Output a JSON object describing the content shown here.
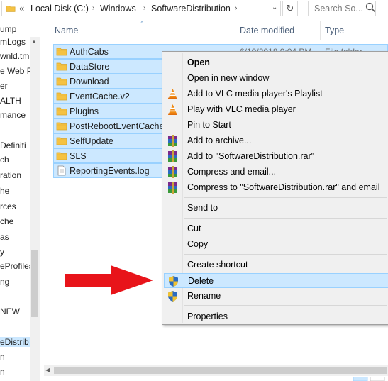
{
  "address": {
    "overflow": "«",
    "crumbs": [
      "Local Disk (C:)",
      "Windows",
      "SoftwareDistribution"
    ],
    "search_placeholder": "Search So..."
  },
  "nav": {
    "items": [
      "ump",
      "mLogs",
      "wnld.tm",
      "e Web P",
      "er",
      "ALTH",
      "mance",
      "Definiti",
      "ch",
      "ration",
      "he",
      "rces",
      "che",
      "as",
      "y",
      "eProfiles",
      "ng",
      "NEW",
      "eDistrib",
      "n",
      "n"
    ],
    "selected_index": 18
  },
  "columns": {
    "name": "Name",
    "date_modified": "Date modified",
    "type": "Type"
  },
  "files": [
    {
      "name": "AuthCabs",
      "kind": "folder",
      "date": "6/10/2018 9:04 PM",
      "type": "File folder"
    },
    {
      "name": "DataStore",
      "kind": "folder",
      "date": "",
      "type": ""
    },
    {
      "name": "Download",
      "kind": "folder",
      "date": "",
      "type": ""
    },
    {
      "name": "EventCache.v2",
      "kind": "folder",
      "date": "",
      "type": ""
    },
    {
      "name": "Plugins",
      "kind": "folder",
      "date": "",
      "type": ""
    },
    {
      "name": "PostRebootEventCache.V",
      "kind": "folder",
      "date": "",
      "type": ""
    },
    {
      "name": "SelfUpdate",
      "kind": "folder",
      "date": "",
      "type": ""
    },
    {
      "name": "SLS",
      "kind": "folder",
      "date": "",
      "type": ""
    },
    {
      "name": "ReportingEvents.log",
      "kind": "file",
      "date": "",
      "type": ""
    }
  ],
  "context_menu": {
    "items": [
      {
        "label": "Open",
        "icon": "",
        "bold": true
      },
      {
        "label": "Open in new window",
        "icon": ""
      },
      {
        "label": "Add to VLC media player's Playlist",
        "icon": "vlc-icon"
      },
      {
        "label": "Play with VLC media player",
        "icon": "vlc-icon"
      },
      {
        "label": "Pin to Start",
        "icon": ""
      },
      {
        "label": "Add to archive...",
        "icon": "winrar-icon"
      },
      {
        "label": "Add to \"SoftwareDistribution.rar\"",
        "icon": "winrar-icon"
      },
      {
        "label": "Compress and email...",
        "icon": "winrar-icon"
      },
      {
        "label": "Compress to \"SoftwareDistribution.rar\" and email",
        "icon": "winrar-icon"
      },
      {
        "label": "Send to",
        "icon": ""
      },
      {
        "label": "Cut",
        "icon": ""
      },
      {
        "label": "Copy",
        "icon": ""
      },
      {
        "label": "Create shortcut",
        "icon": ""
      },
      {
        "label": "Delete",
        "icon": "uac-shield-icon",
        "highlighted": true
      },
      {
        "label": "Rename",
        "icon": "uac-shield-icon"
      },
      {
        "label": "Properties",
        "icon": ""
      }
    ]
  },
  "colors": {
    "selection": "#cce8ff",
    "selection_border": "#99d1ff",
    "menu_bg": "#f0f0f0",
    "arrow": "#e8141a",
    "folder": "#f5c242"
  }
}
